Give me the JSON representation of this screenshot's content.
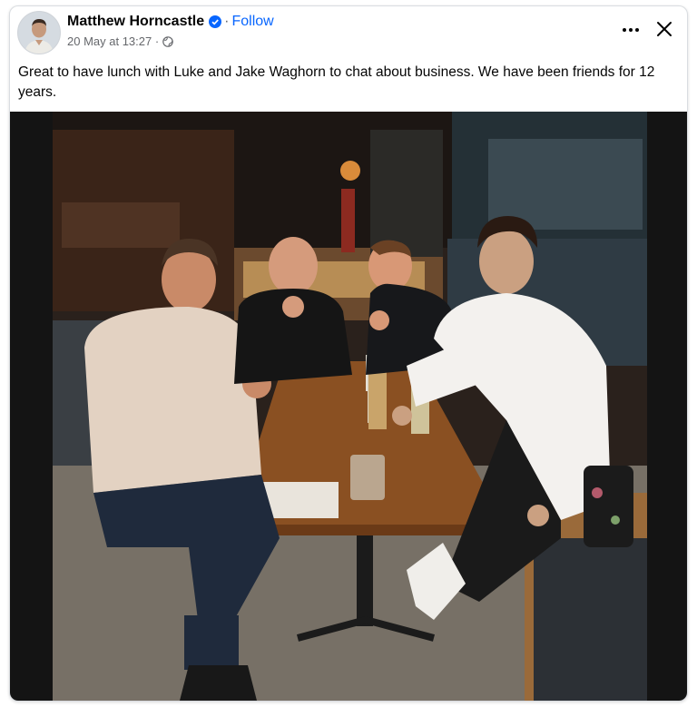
{
  "post": {
    "author": "Matthew Horncastle",
    "separator": "·",
    "follow_label": "Follow",
    "timestamp": "20 May at 13:27 ·",
    "caption": "Great to have lunch with Luke and Jake Waghorn to chat about business. We have been friends for 12 years."
  },
  "icons": {
    "verified": "verified-badge-icon",
    "audience": "globe-icon",
    "more": "more-options-icon",
    "close": "close-icon"
  },
  "colors": {
    "accent": "#0866ff",
    "text": "#050505",
    "secondary": "#65676b"
  }
}
